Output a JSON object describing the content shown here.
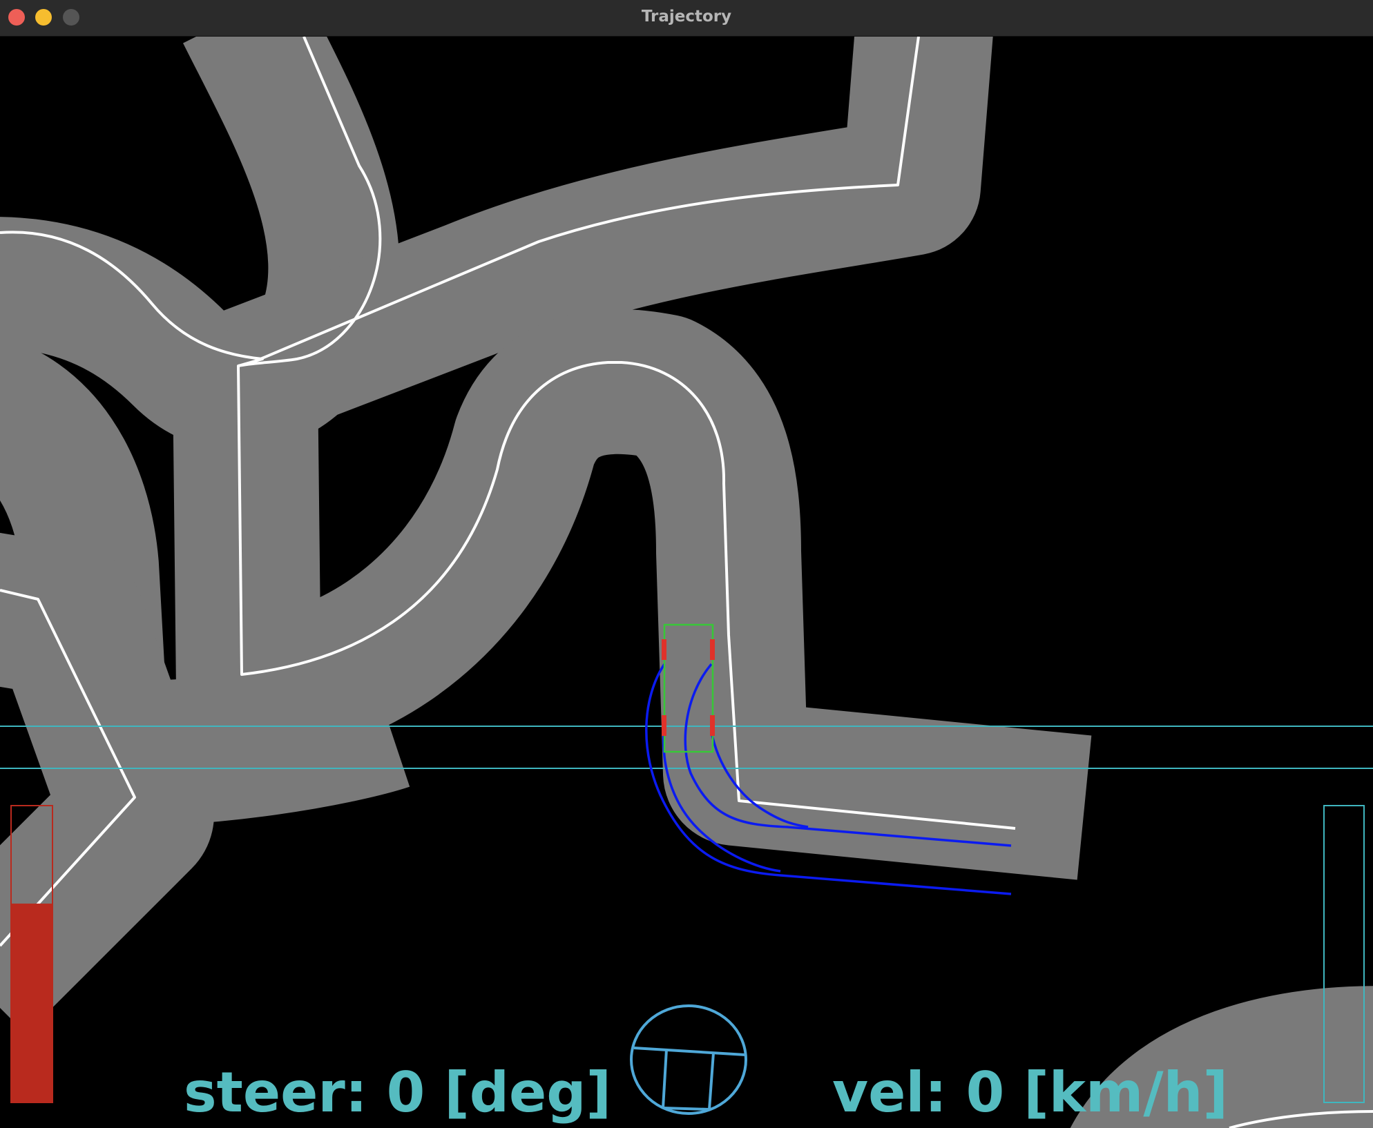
{
  "window": {
    "title": "Trajectory"
  },
  "hud": {
    "steer_text": "steer: 0 [deg]",
    "vel_text": "vel: 0 [km/h]",
    "throttle_fill": 0.67,
    "brake_fill": 0.0
  },
  "colors": {
    "road": "#7a7a7a",
    "background": "#000000",
    "reference_path": "#ffffff",
    "candidate_trajectories": "#0b1bf0",
    "vehicle_outline": "#37c837",
    "vehicle_wheels": "#e0322a",
    "hud_text": "#55bcc0",
    "throttle_bar": "#b92a1e",
    "guide_lines": "#3fb6bf"
  }
}
